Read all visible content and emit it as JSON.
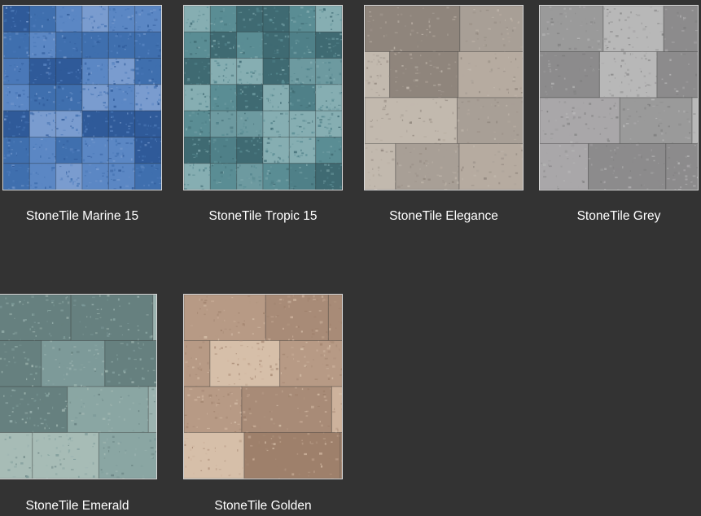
{
  "products": [
    {
      "name": "StoneTile Marine 15",
      "texture": "marine-15-swatch",
      "colors": [
        "#3f6fae",
        "#5b87c4",
        "#2f5a99",
        "#7a9ccf",
        "#4a78b8"
      ]
    },
    {
      "name": "StoneTile Tropic 15",
      "texture": "tropic-15-swatch",
      "colors": [
        "#4f8088",
        "#6d9aa0",
        "#3f6a72",
        "#86aeb2",
        "#5a8d94"
      ]
    },
    {
      "name": "StoneTile Elegance",
      "texture": "elegance-swatch",
      "colors": [
        "#a89f96",
        "#c2b9ae",
        "#8f857c",
        "#b6aba0",
        "#9c9289"
      ]
    },
    {
      "name": "StoneTile Grey",
      "texture": "grey-swatch",
      "colors": [
        "#9a9a9a",
        "#b8b8b8",
        "#7e7e7e",
        "#a9a7a9",
        "#8c8b8c"
      ]
    },
    {
      "name": "StoneTile Emerald",
      "texture": "emerald-swatch",
      "colors": [
        "#7d9a99",
        "#9bb3b0",
        "#66807f",
        "#a7bcb6",
        "#8aa6a3"
      ]
    },
    {
      "name": "StoneTile Golden",
      "texture": "golden-swatch",
      "colors": [
        "#b79a85",
        "#cdb29c",
        "#9e806b",
        "#d6bfa9",
        "#a88b77"
      ]
    }
  ]
}
